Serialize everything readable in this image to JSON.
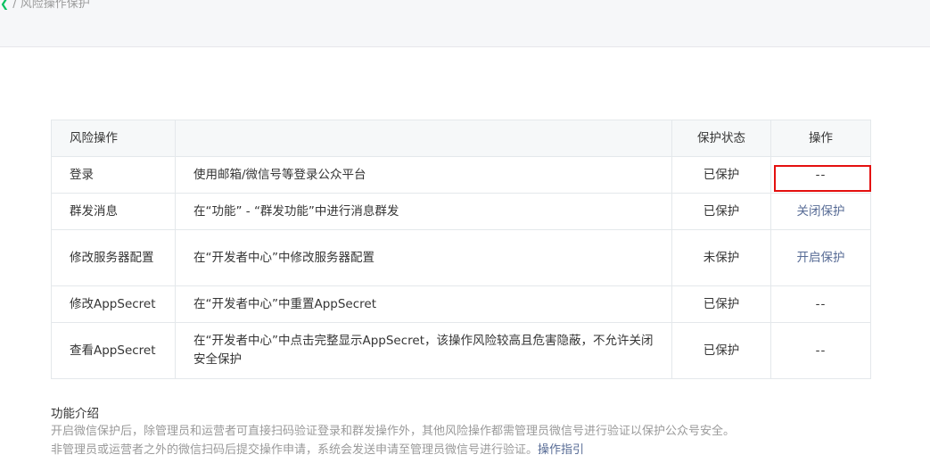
{
  "breadcrumb": {
    "back_icon": "chevron-left-icon",
    "separator": "/",
    "current": "风险操作保护"
  },
  "table": {
    "headers": [
      "风险操作",
      "",
      "保护状态",
      "操作"
    ],
    "rows": [
      {
        "name": "登录",
        "desc": "使用邮箱/微信号等登录公众平台",
        "status": "已保护",
        "action": "--"
      },
      {
        "name": "群发消息",
        "desc": "在“功能” - “群发功能”中进行消息群发",
        "status": "已保护",
        "action": "关闭保护"
      },
      {
        "name": "修改服务器配置",
        "desc": "在“开发者中心”中修改服务器配置",
        "status": "未保护",
        "action": "开启保护"
      },
      {
        "name": "修改AppSecret",
        "desc": "在“开发者中心”中重置AppSecret",
        "status": "已保护",
        "action": "--"
      },
      {
        "name": "查看AppSecret",
        "desc": "在“开发者中心”中点击完整显示AppSecret，该操作风险较高且危害隐蔽，不允许关闭安全保护",
        "status": "已保护",
        "action": "--"
      }
    ]
  },
  "intro": {
    "title": "功能介绍",
    "line1": "开启微信保护后，除管理员和运营者可直接扫码验证登录和群发操作外，其他风险操作都需管理员微信号进行验证以保护公众号安全。",
    "line2": "非管理员或运营者之外的微信扫码后提交操作申请，系统会发送申请至管理员微信号进行验证。",
    "link": "操作指引"
  },
  "colors": {
    "link": "#576b95",
    "muted": "#9a9a9a",
    "highlight": "#e4100f",
    "brand_green": "#07c160"
  }
}
